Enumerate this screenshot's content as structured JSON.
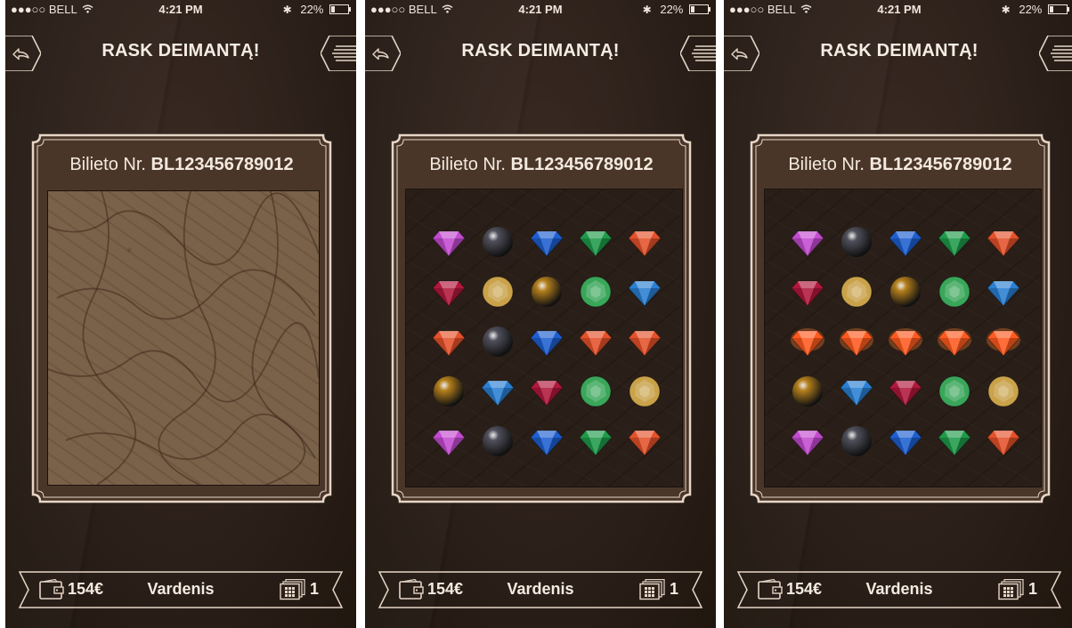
{
  "colors": {
    "frame": "#e6d6c7",
    "amethyst": "#c34bd0",
    "pearl": "#50505c",
    "sapphire": "#1e5fd0",
    "emerald": "#1f9a4a",
    "ruby_orange": "#e4512a",
    "ruby": "#b0183c",
    "citrine": "#c9a24a",
    "gold_pearl": "#b5801c",
    "emerald_round": "#3aa65a",
    "topaz": "#2a7fd2",
    "fire": "#ff5a1f"
  },
  "icons": {
    "back": "back-arrow-icon",
    "menu": "menu-lines-icon",
    "wallet": "wallet-icon",
    "tickets": "ticket-stack-icon",
    "bluetooth": "bluetooth-icon",
    "wifi": "wifi-icon",
    "battery": "battery-icon"
  },
  "screens": [
    {
      "status": {
        "carrier": "●●●○○ BELL",
        "time": "4:21 PM",
        "battery": "22%"
      },
      "title": "RASK DEIMANTĄ!",
      "ticket_prefix": "Bilieto Nr.",
      "ticket_number": "BL123456789012",
      "state": "covered",
      "balance": "154€",
      "user": "Vardenis",
      "tickets": "1",
      "gems": []
    },
    {
      "status": {
        "carrier": "●●●○○ BELL",
        "time": "4:21 PM",
        "battery": "22%"
      },
      "title": "RASK DEIMANTĄ!",
      "ticket_prefix": "Bilieto Nr.",
      "ticket_number": "BL123456789012",
      "state": "revealed",
      "balance": "154€",
      "user": "Vardenis",
      "tickets": "1",
      "gems": [
        [
          "amethyst",
          "pearl",
          "sapphire",
          "emerald",
          "ruby_orange"
        ],
        [
          "ruby",
          "citrine",
          "gold_pearl",
          "emerald_round",
          "topaz"
        ],
        [
          "ruby_orange",
          "pearl",
          "sapphire",
          "ruby_orange",
          "ruby_orange"
        ],
        [
          "gold_pearl",
          "topaz",
          "ruby",
          "emerald_round",
          "citrine"
        ],
        [
          "amethyst",
          "pearl",
          "sapphire",
          "emerald",
          "ruby_orange"
        ]
      ]
    },
    {
      "status": {
        "carrier": "●●●○○ BELL",
        "time": "4:21 PM",
        "battery": "22%"
      },
      "title": "RASK DEIMANTĄ!",
      "ticket_prefix": "Bilieto Nr.",
      "ticket_number": "BL123456789012",
      "state": "winning-row",
      "balance": "154€",
      "user": "Vardenis",
      "tickets": "1",
      "gems": [
        [
          "amethyst",
          "pearl",
          "sapphire",
          "emerald",
          "ruby_orange"
        ],
        [
          "ruby",
          "citrine",
          "gold_pearl",
          "emerald_round",
          "topaz"
        ],
        [
          "fire",
          "fire",
          "fire",
          "fire",
          "fire"
        ],
        [
          "gold_pearl",
          "topaz",
          "ruby",
          "emerald_round",
          "citrine"
        ],
        [
          "amethyst",
          "pearl",
          "sapphire",
          "emerald",
          "ruby_orange"
        ]
      ]
    }
  ]
}
